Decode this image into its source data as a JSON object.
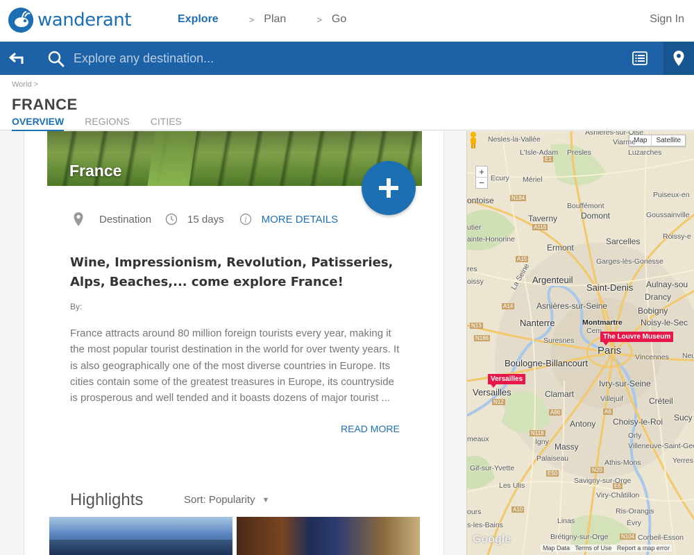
{
  "header": {
    "brand": "wanderant",
    "nav": [
      {
        "label": "Explore",
        "active": true
      },
      {
        "label": "Plan",
        "active": false
      },
      {
        "label": "Go",
        "active": false
      }
    ],
    "nav_separator": ">",
    "sign_in": "Sign In"
  },
  "search": {
    "placeholder": "Explore any destination..."
  },
  "title_strip": {
    "breadcrumb": "World >",
    "title": "FRANCE",
    "tabs": [
      {
        "label": "OVERVIEW",
        "active": true
      },
      {
        "label": "REGIONS",
        "active": false
      },
      {
        "label": "CITIES",
        "active": false
      }
    ]
  },
  "card": {
    "hero_title": "France",
    "add_symbol": "+",
    "meta": {
      "type": "Destination",
      "duration": "15 days",
      "more_details": "MORE DETAILS"
    },
    "headline": "Wine, Impressionism, Revolution, Patisseries, Alps, Beaches,... come explore France!",
    "by": "By:",
    "description": "France attracts around 80 million foreign tourists every year, making it the most popular tourist destination in the world for over twenty years. It is also geographically one of the most diverse countries in Europe. Its cities contain some of the greatest treasures in Europe, its countryside is prosperous and well tended and it boasts dozens of major tourist ...",
    "read_more": "READ MORE",
    "highlights": {
      "title": "Highlights",
      "sort_label": "Sort: Popularity",
      "sort_caret": "▼"
    }
  },
  "map": {
    "type_controls": [
      "Map",
      "Satellite"
    ],
    "zoom": [
      "+",
      "−"
    ],
    "pins": [
      "The Louvre Museum",
      "Versailles"
    ],
    "labels": {
      "vallee": "Nesles-la-Vallée",
      "viarmes": "Viarme",
      "asnieres_top": "Asnières-sur-Oise",
      "isle_adam": "L'Isle-Adam",
      "presles": "Presles",
      "luzarches": "Luzarches",
      "mery": "Mériel",
      "ecury": "Ecury",
      "puiseux": "Puiseux-en",
      "pontoise": "ontoise",
      "bouffemont": "Bouffémont",
      "taverny": "Taverny",
      "domont": "Domont",
      "goussainville": "Goussainville",
      "utier": "utier",
      "conflans": "ainte-Honorine",
      "sarcelles": "Sarcelles",
      "roissy": "Roissy-e",
      "ermont": "Ermont",
      "garges": "Garges-lès-Gonesse",
      "res": "res",
      "oissy": "oissy",
      "laseine": "La Seine",
      "argenteuil": "Argenteuil",
      "saintdenis": "Saint-Denis",
      "aulnay": "Aulnay-sou",
      "drancy": "Drancy",
      "asnieres": "Asnières-sur-Seine",
      "bobigny": "Bobigny",
      "nanterre": "Nanterre",
      "montmartre": "Montmartre",
      "noisy": "Noisy-le-Sec",
      "suresnes": "Suresnes",
      "cem": "Cem",
      "paris": "Paris",
      "vincennes": "Vincennes",
      "neu": "Neu",
      "boulogne": "Boulogne-Billancourt",
      "versailles": "Versailles",
      "ivry": "Ivry-sur-Seine",
      "clamart": "Clamart",
      "villejuif": "Villejuif",
      "creteil": "Créteil",
      "antony": "Antony",
      "choisy": "Choisy-le-Roi",
      "sucy": "Sucy",
      "orly": "Orly",
      "meaux": "meaux",
      "igny": "Igny",
      "massy": "Massy",
      "villeneuve": "Villeneuve-Saint-Geo",
      "palaiseau": "Palaiseau",
      "yerres": "Yerres",
      "athis": "Athis-Mons",
      "gif": "Gif-sur-Yvette",
      "savigny": "Savigny-sur-Orge",
      "ulis": "Les Ulis",
      "viry": "Viry-Châtillon",
      "ris": "Ris-Orangis",
      "ours": "ours",
      "lesbains": "s-les-Bains",
      "linas": "Linas",
      "evry": "Évry",
      "bretigny": "Brétigny-sur-Orge",
      "corbeil": "Corbeil-Esson"
    },
    "shields": [
      "N184",
      "A116",
      "A15",
      "A14",
      "N13",
      "N186",
      "N12",
      "A86",
      "N118",
      "A6",
      "E50",
      "N20",
      "E5",
      "A10",
      "N104",
      "E1"
    ],
    "google": "Google",
    "footer": {
      "data": "Map Data",
      "terms": "Terms of Use",
      "report": "Report a map error"
    }
  }
}
